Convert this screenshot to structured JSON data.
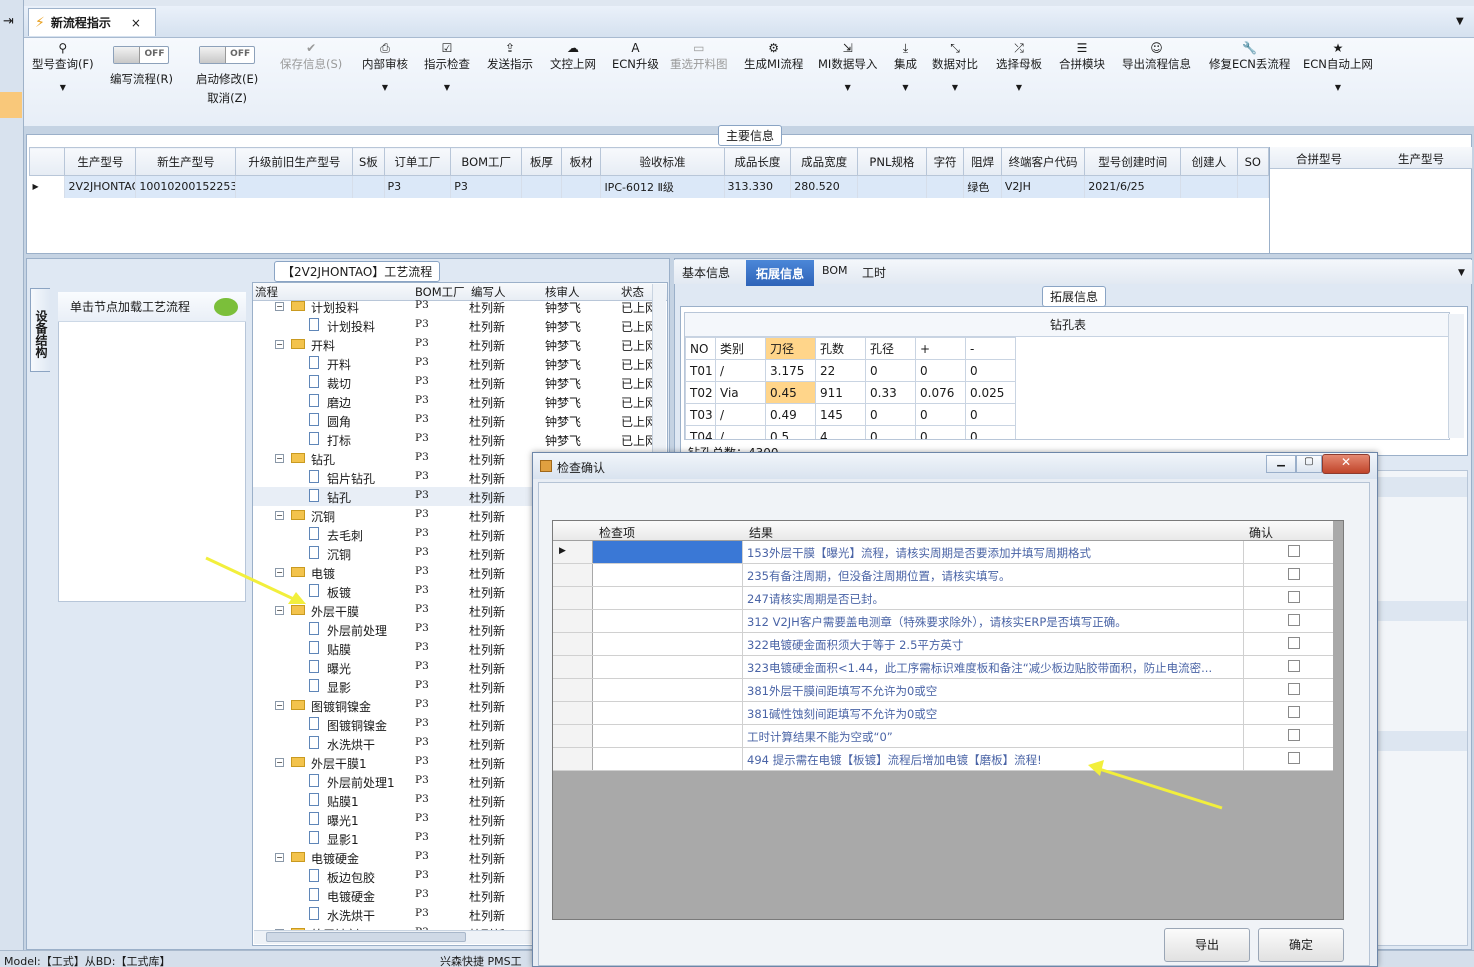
{
  "tab": {
    "title": "新流程指示",
    "close": "×"
  },
  "toolbar": {
    "query": "型号查询(F)",
    "edit_flow": "编写流程(R)",
    "edit_toggle": "OFF",
    "start_modify": "启动修改(E)",
    "start_toggle": "OFF",
    "cancel": "取消(Z)",
    "save": "保存信息(S)",
    "review": "内部审核",
    "check": "指示检查",
    "send": "发送指示",
    "upload": "文控上网",
    "ecn_upgrade": "ECN升级",
    "reselect": "重选开料图",
    "gen_mi": "生成MI流程",
    "mi_import": "MI数据导入",
    "integrate": "集成",
    "compare": "数据对比",
    "motherboard": "选择母板",
    "merge": "合拼模块",
    "export_flow": "导出流程信息",
    "fix_ecn": "修复ECN丢流程",
    "ecn_auto": "ECN自动上网",
    "style": "Style"
  },
  "main_info": {
    "caption": "主要信息",
    "columns": [
      "生产型号",
      "新生产型号",
      "升级前旧生产型号",
      "S板",
      "订单工厂",
      "BOM工厂",
      "板厚",
      "板材",
      "验收标准",
      "成品长度",
      "成品宽度",
      "PNL规格",
      "字符",
      "阻焊",
      "终端客户代码",
      "型号创建时间",
      "创建人",
      "SO"
    ],
    "row": [
      "2V2JHONTAO",
      "10010200152253",
      "",
      "",
      "P3",
      "P3",
      "",
      "",
      "IPC-6012 Ⅱ级",
      "313.330",
      "280.520",
      "",
      "",
      "绿色",
      "V2JH",
      "2021/6/25",
      "",
      ""
    ],
    "merge_columns": [
      "合拼型号",
      "生产型号"
    ]
  },
  "process": {
    "caption": "【2V2JHONTAO】工艺流程",
    "sidetab": "设备结构",
    "hint": "单击节点加载工艺流程",
    "columns": [
      "流程",
      "BOM工厂",
      "编写人",
      "核审人",
      "状态"
    ],
    "rows": [
      {
        "level": 0,
        "name": "计划投料",
        "f": "P3",
        "w": "杜列新",
        "r": "钟梦飞",
        "s": "已上网"
      },
      {
        "level": 1,
        "name": "计划投料",
        "f": "P3",
        "w": "杜列新",
        "r": "钟梦飞",
        "s": "已上网"
      },
      {
        "level": 0,
        "name": "开料",
        "f": "P3",
        "w": "杜列新",
        "r": "钟梦飞",
        "s": "已上网"
      },
      {
        "level": 1,
        "name": "开料",
        "f": "P3",
        "w": "杜列新",
        "r": "钟梦飞",
        "s": "已上网"
      },
      {
        "level": 1,
        "name": "裁切",
        "f": "P3",
        "w": "杜列新",
        "r": "钟梦飞",
        "s": "已上网"
      },
      {
        "level": 1,
        "name": "磨边",
        "f": "P3",
        "w": "杜列新",
        "r": "钟梦飞",
        "s": "已上网"
      },
      {
        "level": 1,
        "name": "圆角",
        "f": "P3",
        "w": "杜列新",
        "r": "钟梦飞",
        "s": "已上网"
      },
      {
        "level": 1,
        "name": "打标",
        "f": "P3",
        "w": "杜列新",
        "r": "钟梦飞",
        "s": "已上网"
      },
      {
        "level": 0,
        "name": "钻孔",
        "f": "P3",
        "w": "杜列新",
        "r": "",
        "s": ""
      },
      {
        "level": 1,
        "name": "铝片钻孔",
        "f": "P3",
        "w": "杜列新",
        "r": "",
        "s": ""
      },
      {
        "level": 1,
        "name": "钻孔",
        "f": "P3",
        "w": "杜列新",
        "r": "",
        "s": ""
      },
      {
        "level": 0,
        "name": "沉铜",
        "f": "P3",
        "w": "杜列新",
        "r": "",
        "s": ""
      },
      {
        "level": 1,
        "name": "去毛刺",
        "f": "P3",
        "w": "杜列新",
        "r": "",
        "s": ""
      },
      {
        "level": 1,
        "name": "沉铜",
        "f": "P3",
        "w": "杜列新",
        "r": "",
        "s": ""
      },
      {
        "level": 0,
        "name": "电镀",
        "f": "P3",
        "w": "杜列新",
        "r": "",
        "s": ""
      },
      {
        "level": 1,
        "name": "板镀",
        "f": "P3",
        "w": "杜列新",
        "r": "",
        "s": ""
      },
      {
        "level": 0,
        "name": "外层干膜",
        "f": "P3",
        "w": "杜列新",
        "r": "",
        "s": ""
      },
      {
        "level": 1,
        "name": "外层前处理",
        "f": "P3",
        "w": "杜列新",
        "r": "",
        "s": ""
      },
      {
        "level": 1,
        "name": "贴膜",
        "f": "P3",
        "w": "杜列新",
        "r": "",
        "s": ""
      },
      {
        "level": 1,
        "name": "曝光",
        "f": "P3",
        "w": "杜列新",
        "r": "",
        "s": ""
      },
      {
        "level": 1,
        "name": "显影",
        "f": "P3",
        "w": "杜列新",
        "r": "",
        "s": ""
      },
      {
        "level": 0,
        "name": "图镀铜镍金",
        "f": "P3",
        "w": "杜列新",
        "r": "",
        "s": ""
      },
      {
        "level": 1,
        "name": "图镀铜镍金",
        "f": "P3",
        "w": "杜列新",
        "r": "",
        "s": ""
      },
      {
        "level": 1,
        "name": "水洗烘干",
        "f": "P3",
        "w": "杜列新",
        "r": "",
        "s": ""
      },
      {
        "level": 0,
        "name": "外层干膜1",
        "f": "P3",
        "w": "杜列新",
        "r": "",
        "s": ""
      },
      {
        "level": 1,
        "name": "外层前处理1",
        "f": "P3",
        "w": "杜列新",
        "r": "",
        "s": ""
      },
      {
        "level": 1,
        "name": "贴膜1",
        "f": "P3",
        "w": "杜列新",
        "r": "",
        "s": ""
      },
      {
        "level": 1,
        "name": "曝光1",
        "f": "P3",
        "w": "杜列新",
        "r": "",
        "s": ""
      },
      {
        "level": 1,
        "name": "显影1",
        "f": "P3",
        "w": "杜列新",
        "r": "",
        "s": ""
      },
      {
        "level": 0,
        "name": "电镀硬金",
        "f": "P3",
        "w": "杜列新",
        "r": "",
        "s": ""
      },
      {
        "level": 1,
        "name": "板边包胶",
        "f": "P3",
        "w": "杜列新",
        "r": "",
        "s": ""
      },
      {
        "level": 1,
        "name": "电镀硬金",
        "f": "P3",
        "w": "杜列新",
        "r": "",
        "s": ""
      },
      {
        "level": 1,
        "name": "水洗烘干",
        "f": "P3",
        "w": "杜列新",
        "r": "",
        "s": ""
      },
      {
        "level": 0,
        "name": "外层蚀刻",
        "f": "P3",
        "w": "杜列新",
        "r": "",
        "s": ""
      }
    ]
  },
  "right": {
    "tabs": [
      "基本信息",
      "拓展信息",
      "BOM",
      "工时"
    ],
    "caption": "拓展信息",
    "drill_title": "钻孔表",
    "drill_columns": [
      "NO",
      "类别",
      "刀径",
      "孔数",
      "孔径",
      "+",
      "-"
    ],
    "drill_rows": [
      [
        "T01",
        "/",
        "3.175",
        "22",
        "0",
        "0",
        "0"
      ],
      [
        "T02",
        "Via",
        "0.45",
        "911",
        "0.33",
        "0.076",
        "0.025"
      ],
      [
        "T03",
        "/",
        "0.49",
        "145",
        "0",
        "0",
        "0"
      ],
      [
        "T04",
        "/",
        "0.5",
        "4",
        "0",
        "0",
        "0"
      ]
    ],
    "drill_total": "钻孔总数：4300"
  },
  "dialog": {
    "title": "检查确认",
    "columns": [
      "检查项",
      "结果",
      "确认"
    ],
    "rows": [
      "153外层干膜【曝光】流程，请核实周期是否要添加并填写周期格式",
      "235有备注周期，但没备注周期位置，请核实填写。",
      "247请核实周期是否已封。",
      "312 V2JH客户需要盖电测章（特殊要求除外），请核实ERP是否填写正确。",
      "322电镀硬金面积须大于等于 2.5平方英寸",
      "323电镀硬金面积<1.44，此工序需标识难度板和备注“减少板边贴胶带面积，防止电流密...",
      "381外层干膜间距填写不允许为0或空",
      "381碱性蚀刻间距填写不允许为0或空",
      "工时计算结果不能为空或“0”",
      "494 提示需在电镀【板镀】流程后增加电镀【磨板】流程!"
    ],
    "export": "导出",
    "ok": "确定"
  },
  "status": {
    "left": "Model:【工式】从BD:【工式库】",
    "mid": "兴森快捷 PMS工"
  },
  "colors": {
    "accent": "#2e63b8",
    "arrow": "#f2ef3c",
    "link_text": "#4a64a6",
    "highlight": "#ffd58a"
  }
}
